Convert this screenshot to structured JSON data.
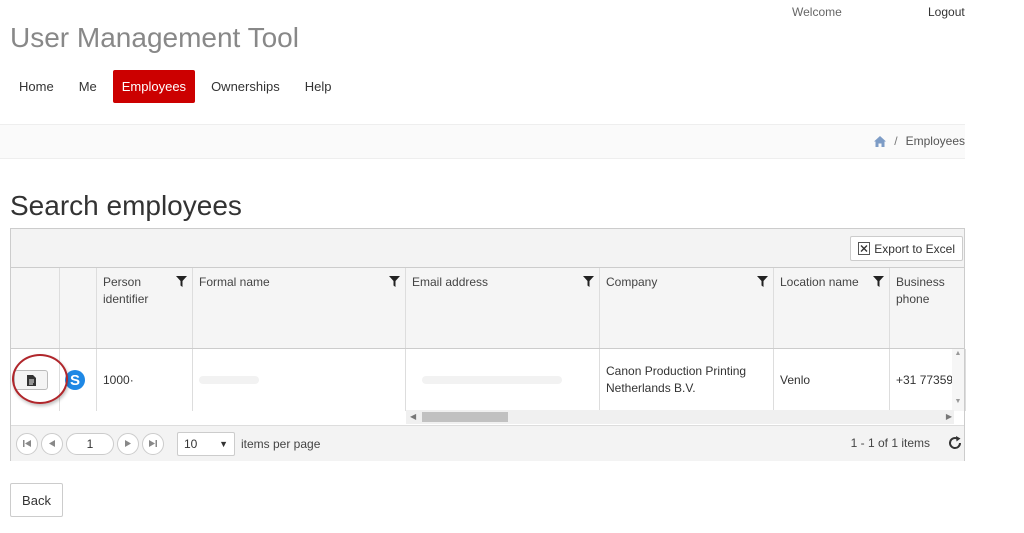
{
  "header": {
    "welcome": "Welcome",
    "logout": "Logout",
    "title": "User Management Tool"
  },
  "nav": {
    "items": [
      {
        "label": "Home",
        "active": false
      },
      {
        "label": "Me",
        "active": false
      },
      {
        "label": "Employees",
        "active": true
      },
      {
        "label": "Ownerships",
        "active": false
      },
      {
        "label": "Help",
        "active": false
      }
    ]
  },
  "breadcrumb": {
    "home_icon": "home-icon",
    "separator": "/",
    "current": "Employees"
  },
  "page": {
    "title": "Search employees",
    "back_label": "Back"
  },
  "grid": {
    "export_label": "Export to Excel",
    "columns": [
      "Person identifier",
      "Formal name",
      "Email address",
      "Company",
      "Location name",
      "Business phone"
    ],
    "rows": [
      {
        "person_identifier": "1000·",
        "formal_name": "",
        "email": "",
        "company": "Canon Production Printing Netherlands B.V.",
        "location": "Venlo",
        "phone": "+31 77359"
      }
    ],
    "pager": {
      "page": "1",
      "page_size": "10",
      "items_per_page": "items per page",
      "info": "1 - 1 of 1 items"
    }
  },
  "colors": {
    "accent": "#cc0000",
    "highlight_circle": "#b0262b",
    "skype": "#1e88e5"
  }
}
